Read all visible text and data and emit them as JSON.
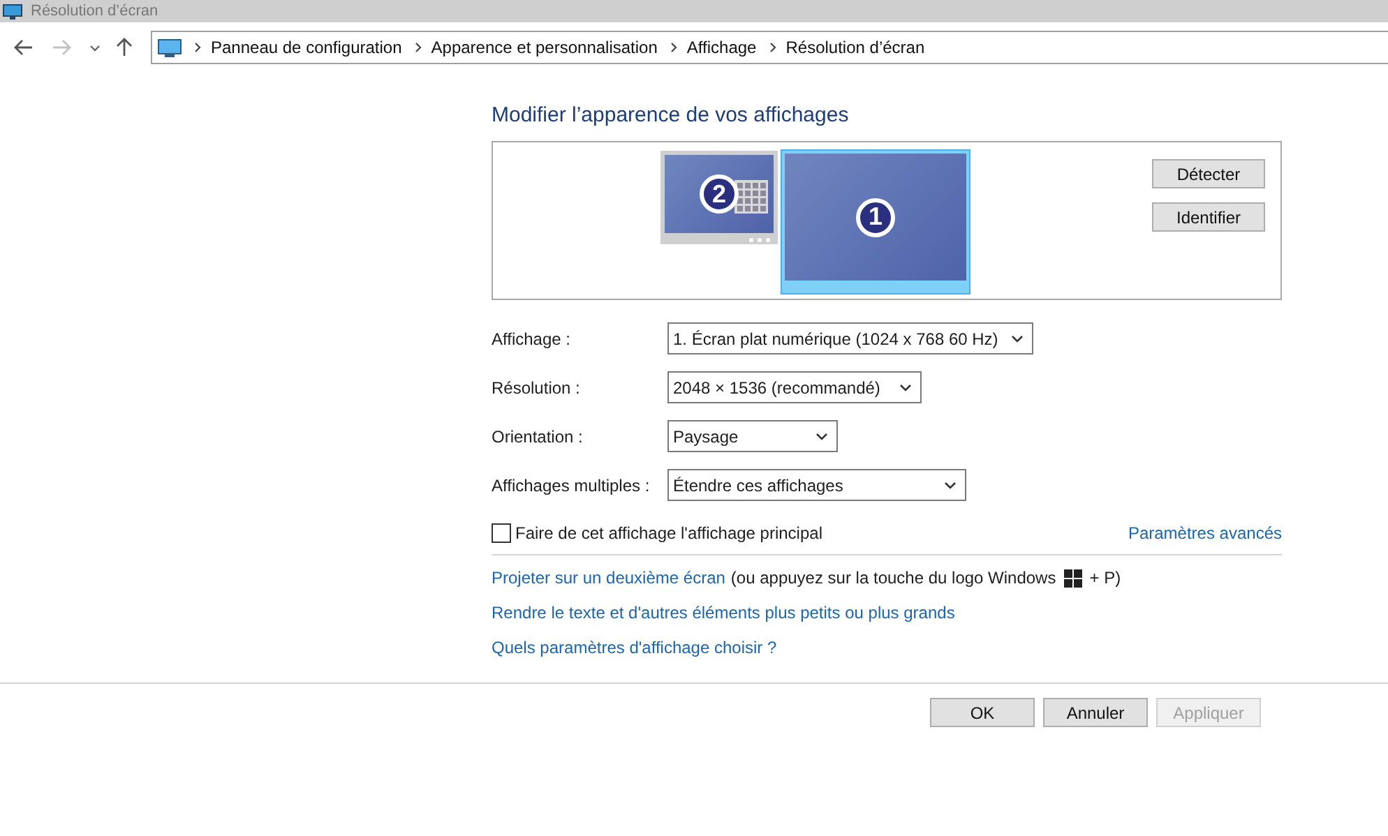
{
  "window": {
    "title": "Résolution d’écran"
  },
  "breadcrumb": [
    "Panneau de configuration",
    "Apparence et personnalisation",
    "Affichage",
    "Résolution d’écran"
  ],
  "heading": "Modifier l’apparence de vos affichages",
  "monitors": [
    {
      "number": "2",
      "selected": false
    },
    {
      "number": "1",
      "selected": true
    }
  ],
  "monitor_buttons": [
    "Détecter",
    "Identifier"
  ],
  "fields": [
    {
      "label": "Affichage :",
      "value": "1. Écran plat numérique (1024 x 768 60 Hz)"
    },
    {
      "label": "Résolution :",
      "value": "2048 × 1536 (recommandé)"
    },
    {
      "label": "Orientation :",
      "value": "Paysage"
    },
    {
      "label": "Affichages multiples :",
      "value": "Étendre ces affichages"
    }
  ],
  "primary_checkbox": {
    "label": "Faire de cet affichage l'affichage principal",
    "checked": false
  },
  "advanced_link": "Paramètres avancés",
  "project": {
    "link": "Projeter sur un deuxième écran",
    "before_logo": "(ou appuyez sur la touche du logo Windows",
    "after_logo": "+ P)"
  },
  "links": [
    "Rendre le texte et d'autres éléments plus petits ou plus grands",
    "Quels paramètres d'affichage choisir ?"
  ],
  "buttons": [
    {
      "label": "OK",
      "disabled": false
    },
    {
      "label": "Annuler",
      "disabled": false
    },
    {
      "label": "Appliquer",
      "disabled": true
    }
  ]
}
